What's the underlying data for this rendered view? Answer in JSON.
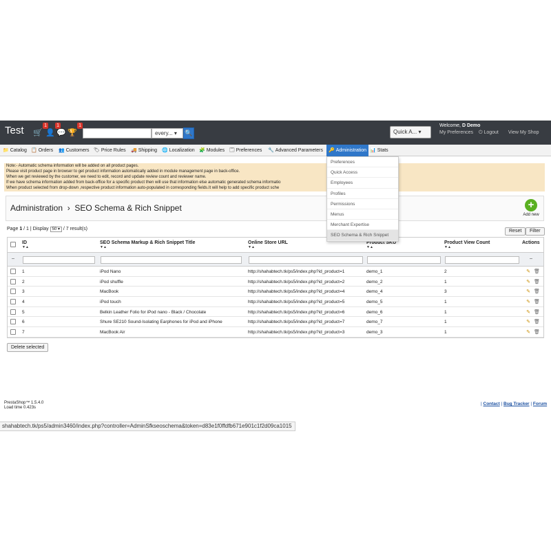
{
  "header": {
    "brand": "Test",
    "notif_badges": [
      "1",
      "1",
      "1"
    ],
    "search_scope": "every...",
    "quick_access": "Quick A...",
    "welcome_prefix": "Welcome,",
    "welcome_user": "D Demo",
    "links": [
      "My Preferences",
      "Logout",
      "View My Shop"
    ]
  },
  "tabs": [
    "Catalog",
    "Orders",
    "Customers",
    "Price Rules",
    "Shipping",
    "Localization",
    "Modules",
    "Preferences",
    "Advanced Parameters",
    "Administration",
    "Stats"
  ],
  "dropdown": [
    "Preferences",
    "Quick Access",
    "Employees",
    "Profiles",
    "Permissions",
    "Menus",
    "Merchant Expertise",
    "SEO Schema & Rich Snippet"
  ],
  "notice": [
    "Note:- Automatic schema information will be added on all product pages.",
    "Please visit product page in browser to get product information automatically added in module management page in back-office.",
    "When we get reviewed by the customer, we need to edit, record and update review count and reviewer name.",
    "If we have schema information added from back-office for a specific product then will use that information else automatic generated schema informatio",
    "When product selected from drop-down ,respective product information auto-populated in corresponding fields.It will help to add specific product sche"
  ],
  "breadcrumb": {
    "parent": "Administration",
    "sep": "›",
    "current": "SEO Schema & Rich Snippet"
  },
  "add_new": "Add new",
  "pagination": {
    "page_label": "Page",
    "page": "1",
    "of": "/ 1",
    "display": "| Display",
    "per_page": "50",
    "results": "/ 7 result(s)"
  },
  "buttons": {
    "reset": "Reset",
    "filter": "Filter",
    "delete_selected": "Delete selected"
  },
  "columns": [
    "ID",
    "SEO Schema Markup & Rich Snippet Title",
    "Online Store URL",
    "Product SKU",
    "Product View Count",
    "Actions"
  ],
  "filter_ellipsis": "--",
  "rows": [
    {
      "id": "1",
      "title": "iPod Nano",
      "url": "http://shahabtech.tk/ps5/index.php?id_product=1",
      "sku": "demo_1",
      "count": "2"
    },
    {
      "id": "2",
      "title": "iPod shuffle",
      "url": "http://shahabtech.tk/ps5/index.php?id_product=2",
      "sku": "demo_2",
      "count": "1"
    },
    {
      "id": "3",
      "title": "MacBook",
      "url": "http://shahabtech.tk/ps5/index.php?id_product=4",
      "sku": "demo_4",
      "count": "3"
    },
    {
      "id": "4",
      "title": "iPod touch",
      "url": "http://shahabtech.tk/ps5/index.php?id_product=5",
      "sku": "demo_5",
      "count": "1"
    },
    {
      "id": "5",
      "title": "Belkin Leather Folio for iPod nano - Black / Chocolate",
      "url": "http://shahabtech.tk/ps5/index.php?id_product=6",
      "sku": "demo_6",
      "count": "1"
    },
    {
      "id": "6",
      "title": "Shure SE210 Sound-Isolating Earphones for iPod and iPhone",
      "url": "http://shahabtech.tk/ps5/index.php?id_product=7",
      "sku": "demo_7",
      "count": "1"
    },
    {
      "id": "7",
      "title": "MacBook Air",
      "url": "http://shahabtech.tk/ps5/index.php?id_product=3",
      "sku": "demo_3",
      "count": "1"
    }
  ],
  "footer": {
    "version": "PrestaShop™ 1.5.4.0",
    "load_time": "Load time 0.423s",
    "links": [
      "Contact",
      "Bug Tracker",
      "Forum"
    ]
  },
  "status_url": "shahabtech.tk/ps5/admin3460/index.php?controller=AdminSfkseoschema&token=d83e1f0ffdfb671e901c1f2d09ca1015",
  "colors": {
    "header_bg": "#383c42",
    "active_tab": "#2f77c9",
    "notice_bg": "#f8e6c4",
    "add_green": "#5ab021"
  }
}
